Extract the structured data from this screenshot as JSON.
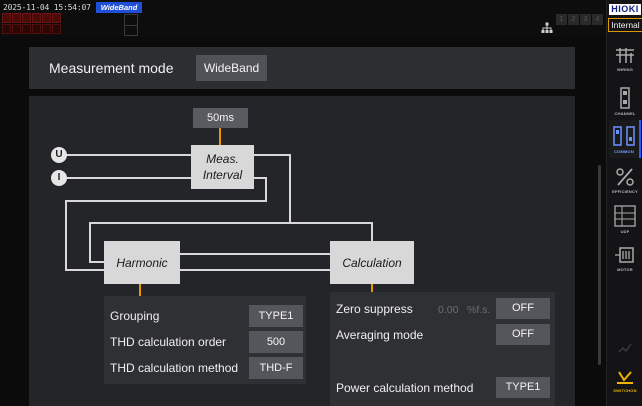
{
  "status": {
    "datetime": "2025-11-04 15:54:07",
    "mode_tag": "WideBand",
    "channels": [
      "1",
      "2",
      "3",
      "4"
    ]
  },
  "sidepanel": {
    "brand": "HIOKI",
    "clock_source": "Internal",
    "items": [
      {
        "label": "WIRING",
        "icon": "wiring-icon",
        "active": false
      },
      {
        "label": "CHANNEL",
        "icon": "channel-icon",
        "active": false
      },
      {
        "label": "COMMON",
        "icon": "common-icon",
        "active": true
      },
      {
        "label": "EFFICIENCY",
        "icon": "efficiency-icon",
        "active": false
      },
      {
        "label": "UDF",
        "icon": "udf-icon",
        "active": false
      },
      {
        "label": "MOTOR",
        "icon": "motor-icon",
        "active": false
      }
    ],
    "switch_label": "SWITCHON"
  },
  "header": {
    "title": "Measurement mode",
    "mode_value": "WideBand"
  },
  "diagram": {
    "interval_value": "50ms",
    "input_u": "U",
    "input_i": "I",
    "meas_interval_line1": "Meas.",
    "meas_interval_line2": "Interval",
    "harmonic": "Harmonic",
    "calculation": "Calculation"
  },
  "harmonic_settings": {
    "grouping_label": "Grouping",
    "grouping_value": "TYPE1",
    "thd_order_label": "THD calculation order",
    "thd_order_value": "500",
    "thd_method_label": "THD calculation method",
    "thd_method_value": "THD-F"
  },
  "calculation_settings": {
    "zero_suppress_label": "Zero suppress",
    "zero_suppress_amount": "0.00",
    "zero_suppress_unit": "%f.s.",
    "zero_suppress_value": "OFF",
    "averaging_label": "Averaging mode",
    "averaging_value": "OFF",
    "power_method_label": "Power calculation method",
    "power_method_value": "TYPE1"
  },
  "colors": {
    "accent_blue": "#2a5cff",
    "orange_line": "#e39a00",
    "brand_navy": "#10207a"
  }
}
